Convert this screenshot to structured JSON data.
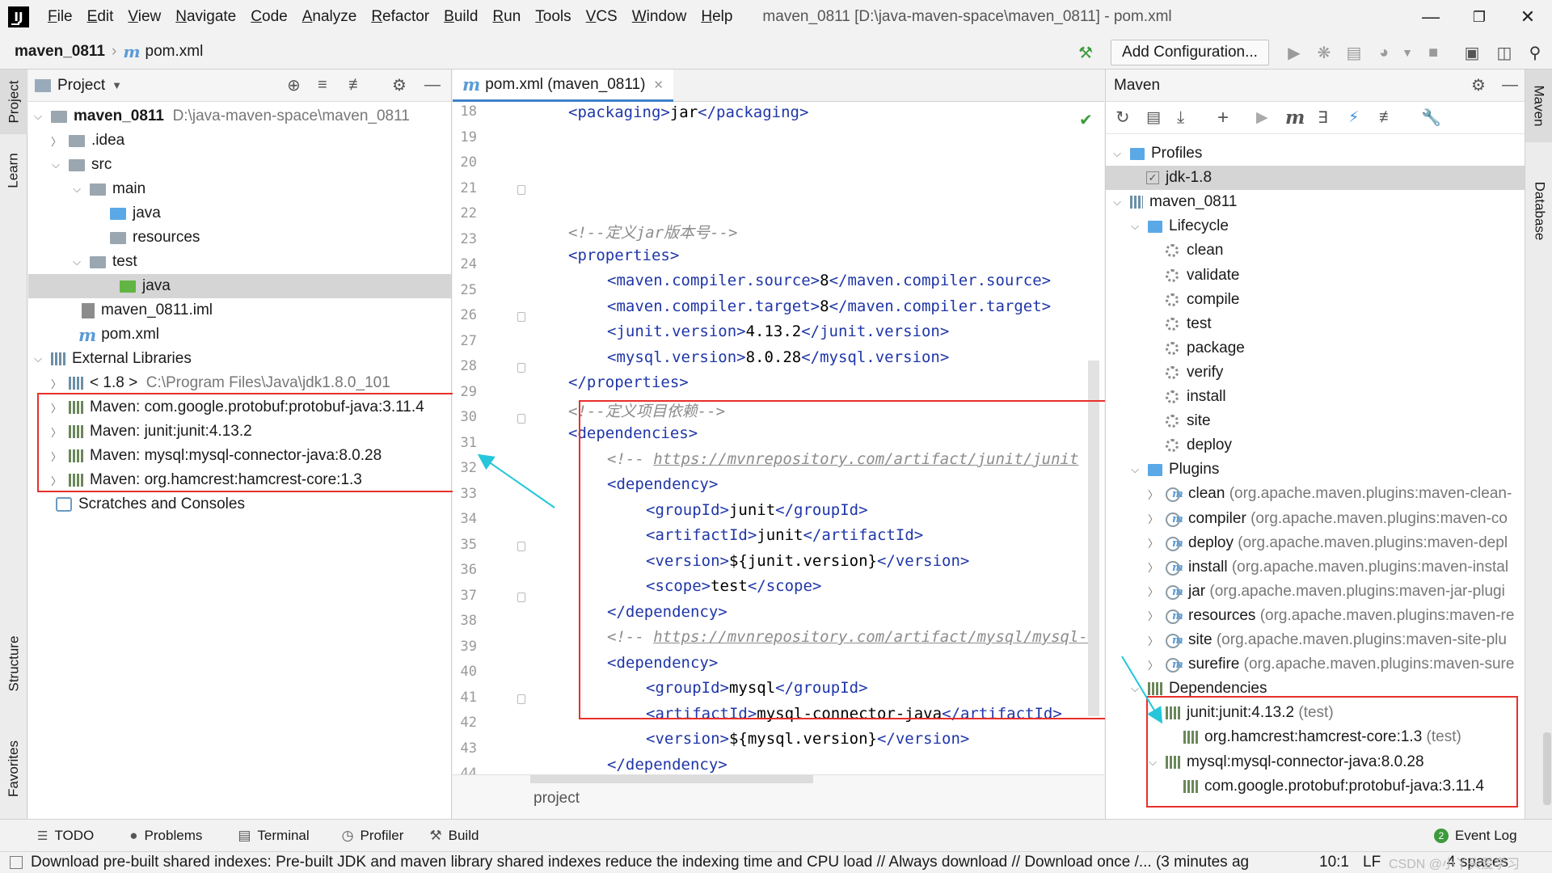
{
  "titlebar": {
    "menus": [
      "File",
      "Edit",
      "View",
      "Navigate",
      "Code",
      "Analyze",
      "Refactor",
      "Build",
      "Run",
      "Tools",
      "VCS",
      "Window",
      "Help"
    ],
    "window_title": "maven_0811 [D:\\java-maven-space\\maven_0811] - pom.xml"
  },
  "navbar": {
    "project": "maven_0811",
    "file": "pom.xml",
    "add_config_label": "Add Configuration..."
  },
  "left_stripe": {
    "project": "Project",
    "learn": "Learn",
    "structure": "Structure",
    "favorites": "Favorites"
  },
  "project_panel": {
    "title": "Project",
    "tree": [
      {
        "label": "maven_0811",
        "path": "D:\\java-maven-space\\maven_0811"
      },
      {
        "label": ".idea"
      },
      {
        "label": "src"
      },
      {
        "label": "main"
      },
      {
        "label": "java"
      },
      {
        "label": "resources"
      },
      {
        "label": "test"
      },
      {
        "label": "java"
      },
      {
        "label": "maven_0811.iml"
      },
      {
        "label": "pom.xml"
      },
      {
        "label": "External Libraries"
      },
      {
        "label": "< 1.8 >",
        "path": "C:\\Program Files\\Java\\jdk1.8.0_101"
      },
      {
        "label": "Maven: com.google.protobuf:protobuf-java:3.11.4"
      },
      {
        "label": "Maven: junit:junit:4.13.2"
      },
      {
        "label": "Maven: mysql:mysql-connector-java:8.0.28"
      },
      {
        "label": "Maven: org.hamcrest:hamcrest-core:1.3"
      },
      {
        "label": "Scratches and Consoles"
      }
    ]
  },
  "editor": {
    "tab_label": "pom.xml (maven_0811)",
    "line_numbers": [
      "18",
      "19",
      "20",
      "21",
      "22",
      "23",
      "24",
      "25",
      "26",
      "27",
      "28",
      "29",
      "30",
      "31",
      "32",
      "33",
      "34",
      "35",
      "36",
      "37",
      "38",
      "39",
      "40",
      "41",
      "42",
      "43",
      "44"
    ],
    "comment_jar": "<!--定义jar版本号-->",
    "comment_deps": "<!--定义项目依赖-->",
    "url_junit": "https://mvnrepository.com/artifact/junit/junit",
    "url_mysql": "https://mvnrepository.com/artifact/mysql/mysql-",
    "breadcrumb_footer": "project",
    "code": {
      "packaging": "jar",
      "compiler_source": "8",
      "compiler_target": "8",
      "junit_version": "4.13.2",
      "mysql_version": "8.0.28",
      "junit_group": "junit",
      "junit_artifact": "junit",
      "junit_version_ref": "${junit.version}",
      "junit_scope": "test",
      "mysql_group": "mysql",
      "mysql_artifact": "mysql-connector-java",
      "mysql_version_ref": "${mysql.version}"
    }
  },
  "maven_panel": {
    "title": "Maven",
    "profiles_label": "Profiles",
    "profile_jdk": "jdk-1.8",
    "project": "maven_0811",
    "lifecycle_label": "Lifecycle",
    "lifecycle": [
      "clean",
      "validate",
      "compile",
      "test",
      "package",
      "verify",
      "install",
      "site",
      "deploy"
    ],
    "plugins_label": "Plugins",
    "plugins": [
      {
        "name": "clean",
        "detail": "(org.apache.maven.plugins:maven-clean-"
      },
      {
        "name": "compiler",
        "detail": "(org.apache.maven.plugins:maven-co"
      },
      {
        "name": "deploy",
        "detail": "(org.apache.maven.plugins:maven-depl"
      },
      {
        "name": "install",
        "detail": "(org.apache.maven.plugins:maven-instal"
      },
      {
        "name": "jar",
        "detail": "(org.apache.maven.plugins:maven-jar-plugi"
      },
      {
        "name": "resources",
        "detail": "(org.apache.maven.plugins:maven-re"
      },
      {
        "name": "site",
        "detail": "(org.apache.maven.plugins:maven-site-plu"
      },
      {
        "name": "surefire",
        "detail": "(org.apache.maven.plugins:maven-sure"
      }
    ],
    "dependencies_label": "Dependencies",
    "dependencies": [
      {
        "name": "junit:junit:4.13.2",
        "detail": "(test)"
      },
      {
        "name": "org.hamcrest:hamcrest-core:1.3",
        "detail": "(test)"
      },
      {
        "name": "mysql:mysql-connector-java:8.0.28",
        "detail": ""
      },
      {
        "name": "com.google.protobuf:protobuf-java:3.11.4",
        "detail": ""
      }
    ]
  },
  "right_stripe": {
    "maven": "Maven",
    "database": "Database"
  },
  "toolwindows": {
    "todo": "TODO",
    "problems": "Problems",
    "terminal": "Terminal",
    "profiler": "Profiler",
    "build": "Build",
    "event_log": "Event Log"
  },
  "statusbar": {
    "message": "Download pre-built shared indexes: Pre-built JDK and maven library shared indexes reduce the indexing time and CPU load // Always download // Download once /... (3 minutes ag",
    "position": "10:1",
    "line_sep": "LF",
    "indent": "4 spaces",
    "watermark": "CSDN @小丫头爱学习"
  },
  "colors": {
    "accent": "#4083c9",
    "annotation": "#e8302a",
    "tag": "#1f36a8",
    "arrow": "#26c6da"
  }
}
